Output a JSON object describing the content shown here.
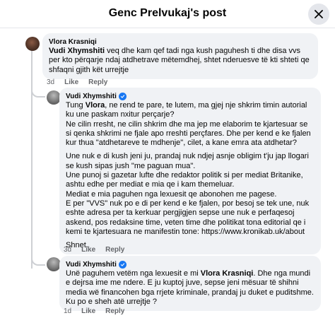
{
  "header": {
    "title": "Genc Prelvukaj's post",
    "close_icon": "close-icon"
  },
  "comments": [
    {
      "author": "Vlora Krasniqi",
      "verified": false,
      "mention": "Vudi Xhymshiti",
      "text": " veq dhe kam qef tadi nga kush paguhesh ti dhe disa vvs per kto përqarje ndaj atdhetrave mëtemdhej, shtet nderuesve të kti shteti qe shfaqni gjith kët urrejtje",
      "time": "3d",
      "like": "Like",
      "reply": "Reply"
    },
    {
      "author": "Vudi Xhymshiti",
      "verified": true,
      "para1_pre": "Tung ",
      "para1_mention": "Vlora",
      "para1_post": ", ne rend te pare, te lutem, ma gjej nje shkrim timin autorial ku une paskam nxitur perçarje?",
      "para2": "Ne cilin rresht, ne cilin shkrim dhe ma jep me elaborim te kjartesuar se si qenka shkrimi ne fjale apo rreshti perçfares. Dhe per kend e ke fjalen kur thua \"atdhetareve te mdhenje\", cilet, a kane emra ata atdhetar?",
      "para3": "Une nuk e di kush jeni ju, prandaj nuk ndjej asnje obligim t'ju jap llogari se kush sipas jush \"me paguan mua\".",
      "para4": "Une punoj si gazetar lufte dhe redaktor politik si per mediat Britanike, ashtu edhe per mediat e mia qe i kam themeluar.",
      "para5": "Mediat e mia paguhen nga lexuesit qe abonohen me pagese.",
      "para6": "E per \"VVS\" nuk po e di per kend e ke fjalen, por besoj se tek une, nuk eshte adresa per ta kerkuar pergjigjen sepse une nuk e perfaqesoj askend, pos redaksine time, veten time dhe politikat tona editorial qe i kemi te kjartesuara ne manifestin tone: https://www.kronikab.uk/about",
      "para7": "Shnet.",
      "time": "3d",
      "like": "Like",
      "reply": "Reply"
    },
    {
      "author": "Vudi Xhymshiti",
      "verified": true,
      "text_pre": "Unë paguhem vetëm nga lexuesit e mi ",
      "text_mention": "Vlora Krasniqi",
      "text_post": ". Dhe nga mundi e dejrsa ime me ndere. E ju kuptoj juve, sepse jeni mësuar të shihni media wë financohen bga rrjete kriminale, prandaj ju duket e puditshme. Ku po e sheh atë urrejtje ?",
      "time": "1d",
      "like": "Like",
      "reply": "Reply"
    }
  ]
}
